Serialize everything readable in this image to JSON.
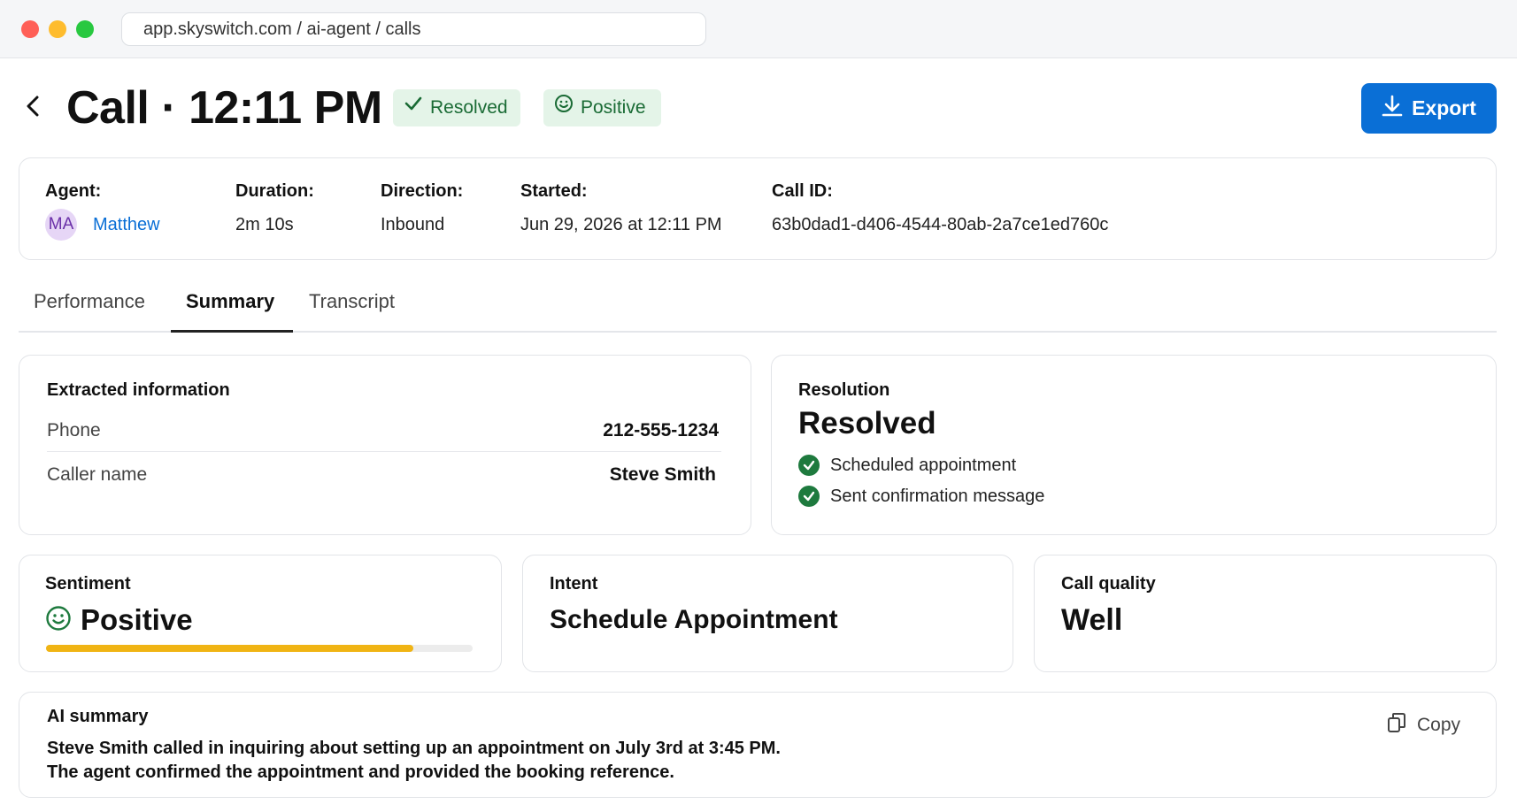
{
  "browser": {
    "url": "app.skyswitch.com / ai-agent / calls"
  },
  "header": {
    "title": "Call · 12:11 PM",
    "status_badge": "Resolved",
    "sentiment_badge": "Positive",
    "export_label": "Export"
  },
  "call_info": {
    "agent_label": "Agent:",
    "agent_initials": "MA",
    "agent_name": "Matthew",
    "duration_label": "Duration:",
    "duration_value": "2m 10s",
    "direction_label": "Direction:",
    "direction_value": "Inbound",
    "started_label": "Started:",
    "started_value": "Jun 29, 2026 at 12:11 PM",
    "call_id_label": "Call ID:",
    "call_id_value": "63b0dad1-d406-4544-80ab-2a7ce1ed760c"
  },
  "tabs": [
    {
      "label": "Performance",
      "active": false
    },
    {
      "label": "Summary",
      "active": true
    },
    {
      "label": "Transcript",
      "active": false
    }
  ],
  "extracted": {
    "title": "Extracted information",
    "rows": [
      {
        "label": "Phone",
        "value": "212-555-1234"
      },
      {
        "label": "Caller name",
        "value": "Steve Smith"
      }
    ]
  },
  "resolution": {
    "title": "Resolution",
    "value": "Resolved",
    "items": [
      "Scheduled appointment",
      "Sent confirmation message"
    ]
  },
  "sentiment": {
    "title": "Sentiment",
    "value": "Positive",
    "score_fraction": 0.86
  },
  "intent": {
    "title": "Intent",
    "value": "Schedule Appointment"
  },
  "quality": {
    "title": "Call quality",
    "value": "Well"
  },
  "ai_summary": {
    "title": "AI summary",
    "line1": "Steve Smith called in inquiring about setting up an appointment on July 3rd at 3:45 PM.",
    "line2": "The agent confirmed the appointment and provided the booking reference.",
    "copy_label": "Copy"
  },
  "colors": {
    "accent": "#0a6fd6",
    "success": "#1e7a3e",
    "success_bg": "#e4f4e8",
    "progress": "#f0b414"
  }
}
